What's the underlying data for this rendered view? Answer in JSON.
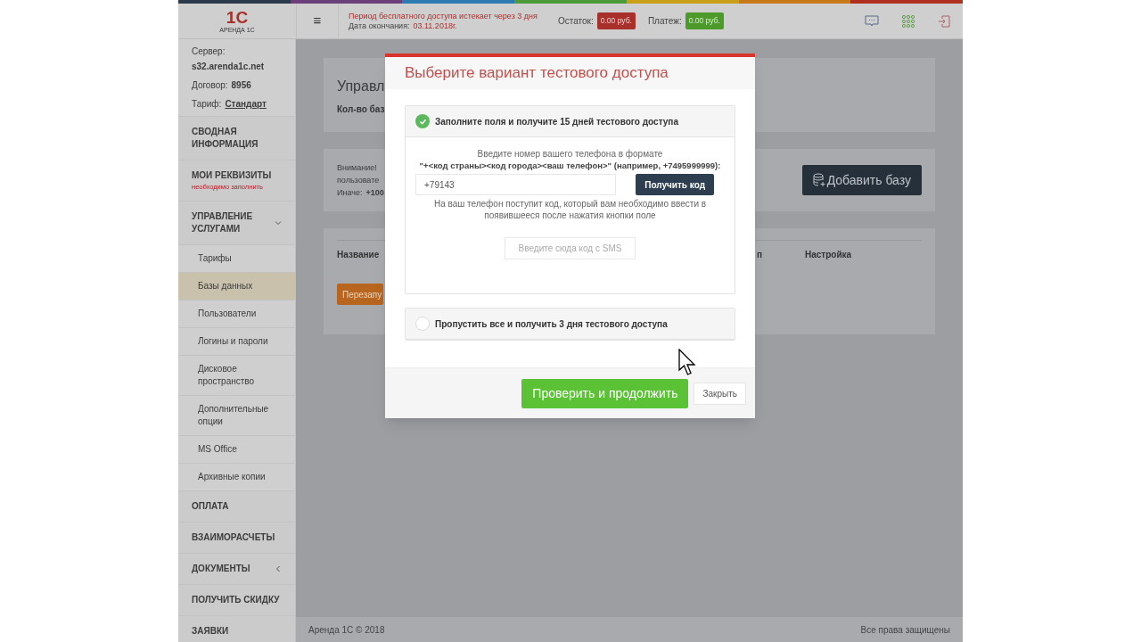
{
  "top_bar": {
    "logo_mark": "1С",
    "logo_text": "АРЕНДА 1С",
    "menu_glyph": "≡",
    "trial_notice": "Период бесплатного доступа истекает через 3 дня",
    "end_date_label": "Дата окончания:",
    "end_date": "03.11.2018г.",
    "balance_label": "Остаток:",
    "balance": "0.00 руб.",
    "payment_label": "Платеж:",
    "payment": "0.00 руб."
  },
  "sidebar": {
    "server_label": "Сервер:",
    "server": "s32.arenda1c.net",
    "contract_label": "Договор:",
    "contract": "8956",
    "tariff_label": "Тариф:",
    "tariff": "Стандарт",
    "menu": [
      {
        "label": "СВОДНАЯ ИНФОРМАЦИЯ",
        "kind": "link"
      },
      {
        "label": "МОИ РЕКВИЗИТЫ",
        "kind": "link",
        "note": "необходимо заполнить"
      },
      {
        "label": "УПРАВЛЕНИЕ УСЛУГАМИ",
        "kind": "group",
        "expanded": true,
        "children": [
          {
            "label": "Тарифы",
            "selected": false
          },
          {
            "label": "Базы данных",
            "selected": true
          },
          {
            "label": "Пользователи",
            "selected": false
          },
          {
            "label": "Логины и пароли",
            "selected": false
          },
          {
            "label": "Дисковое пространство",
            "selected": false
          },
          {
            "label": "Дополнительные опции",
            "selected": false
          },
          {
            "label": "MS Office",
            "selected": false
          },
          {
            "label": "Архивные копии",
            "selected": false
          }
        ]
      },
      {
        "label": "ОПЛАТА",
        "kind": "link"
      },
      {
        "label": "ВЗАИМОРАСЧЕТЫ",
        "kind": "link"
      },
      {
        "label": "ДОКУМЕНТЫ",
        "kind": "group",
        "expanded": false
      },
      {
        "label": "ПОЛУЧИТЬ СКИДКУ",
        "kind": "link"
      },
      {
        "label": "ЗАЯВКИ",
        "kind": "link"
      }
    ]
  },
  "main": {
    "heading": "Управл",
    "db_count": "Кол-во баз",
    "notice_lines": [
      "Внимание!",
      "пользовате",
      "Иначе:"
    ],
    "notice_bold": "+100",
    "add_button": "Добавить базу",
    "table_columns": [
      "Название",
      "п",
      "Настройка"
    ],
    "restart_button": "Перезапу"
  },
  "footer": {
    "copyright": "Аренда 1С © 2018",
    "rights": "Все права защищены"
  },
  "modal": {
    "title": "Выберите вариант тестового доступа",
    "options": [
      {
        "label": "Заполните поля и получите 15 дней тестового доступа",
        "selected": true
      },
      {
        "label": "Пропустить все и получить 3 дня тестового доступа",
        "selected": false
      }
    ],
    "instruction": "Введите номер вашего телефона в формате",
    "format": "\"+<код страны><код города><ваш телефон>\" (например, +7495999999):",
    "phone": "+79143",
    "get_code_button": "Получить код",
    "code_note": "На ваш телефон поступит код, который вам необходимо ввести в появившееся после нажатия кнопки поле",
    "sms_placeholder": "Введите сюда код с SMS",
    "continue_button": "Проверить и продолжить",
    "close_button": "Закрыть"
  }
}
